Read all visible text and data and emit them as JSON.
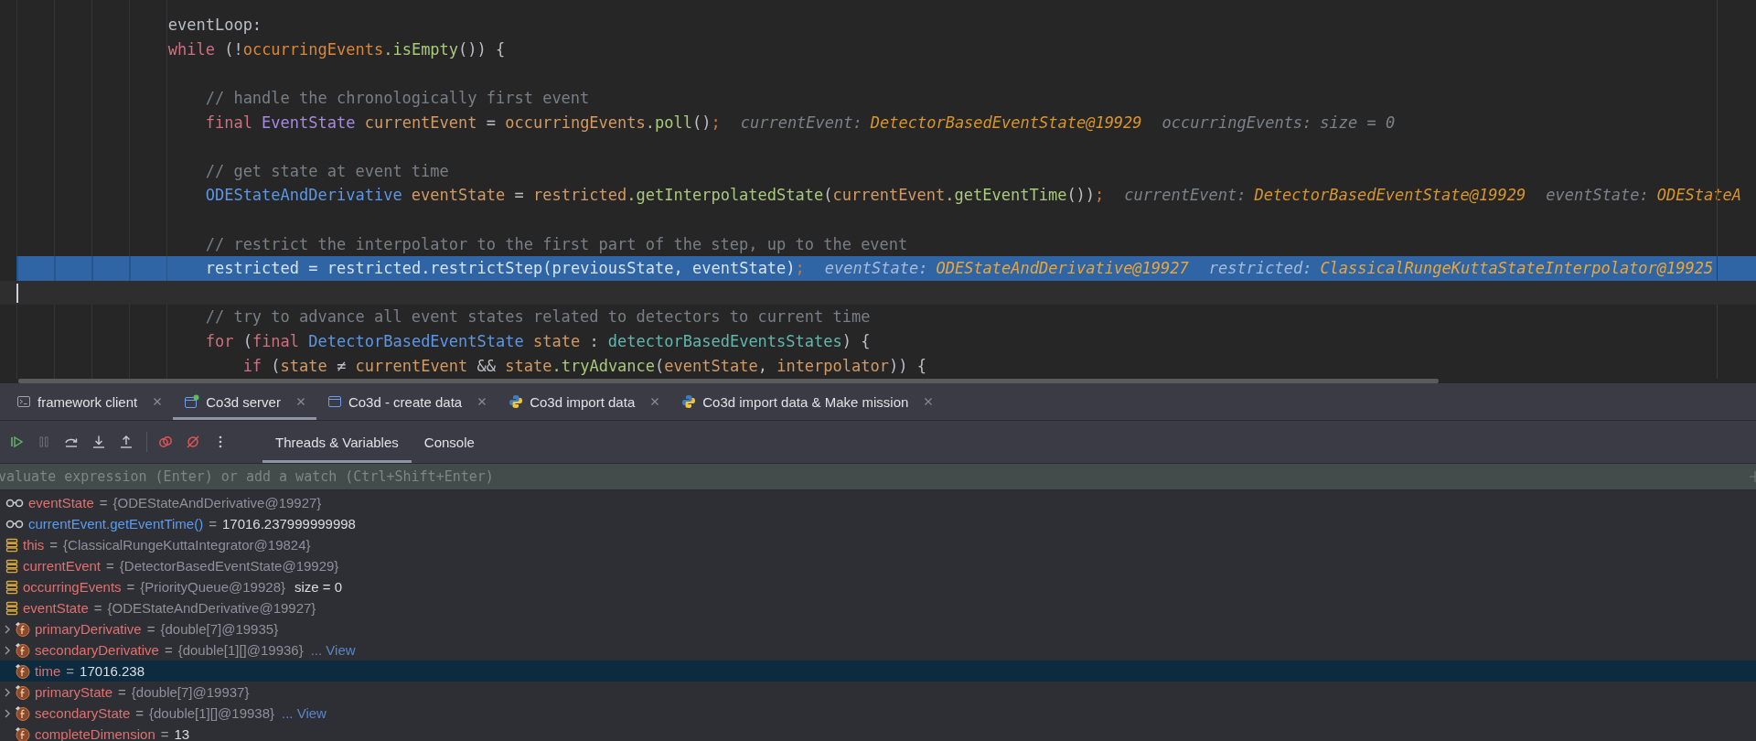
{
  "editor": {
    "lines": [
      {
        "kind": "code",
        "tokens": [
          {
            "kind": "label",
            "text": "                eventLoop:"
          }
        ]
      },
      {
        "kind": "code",
        "tokens": [
          {
            "kind": "kw",
            "text": "                while"
          },
          {
            "kind": "plain",
            "text": " (!"
          },
          {
            "kind": "field",
            "text": "occurringEvents"
          },
          {
            "kind": "method",
            "text": ".isEmpty"
          },
          {
            "kind": "plain",
            "text": "()) {"
          }
        ]
      },
      {
        "kind": "blank"
      },
      {
        "kind": "code",
        "tokens": [
          {
            "kind": "comment",
            "text": "                    // handle the chronologically first event"
          }
        ]
      },
      {
        "kind": "code",
        "tokens": [
          {
            "kind": "kw",
            "text": "                    final "
          },
          {
            "kind": "type2",
            "text": "EventState "
          },
          {
            "kind": "local",
            "text": "currentEvent"
          },
          {
            "kind": "plain",
            "text": " = "
          },
          {
            "kind": "local",
            "text": "occurringEvents"
          },
          {
            "kind": "method",
            "text": ".poll"
          },
          {
            "kind": "plain",
            "text": "()"
          },
          {
            "kind": "semi",
            "text": ";"
          }
        ],
        "hints": [
          {
            "label": "currentEvent:",
            "value": {
              "text": "DetectorBasedEventState@19929",
              "color": "#d8952c"
            }
          },
          {
            "label": "occurringEvents:",
            "value": {
              "text": "size = 0",
              "color": "#7d8188"
            }
          }
        ]
      },
      {
        "kind": "blank"
      },
      {
        "kind": "code",
        "tokens": [
          {
            "kind": "comment",
            "text": "                    // get state at event time"
          }
        ]
      },
      {
        "kind": "code",
        "tokens": [
          {
            "kind": "type",
            "text": "                    ODEStateAndDerivative "
          },
          {
            "kind": "local",
            "text": "eventState"
          },
          {
            "kind": "plain",
            "text": " = "
          },
          {
            "kind": "local",
            "text": "restricted"
          },
          {
            "kind": "method",
            "text": ".getInterpolatedState"
          },
          {
            "kind": "plain",
            "text": "("
          },
          {
            "kind": "local",
            "text": "currentEvent"
          },
          {
            "kind": "method",
            "text": ".getEventTime"
          },
          {
            "kind": "plain",
            "text": "())"
          },
          {
            "kind": "semi",
            "text": ";"
          }
        ],
        "hints": [
          {
            "label": "currentEvent:",
            "value": {
              "text": "DetectorBasedEventState@19929",
              "color": "#d8952c"
            }
          },
          {
            "label": "eventState:",
            "value": {
              "text": "ODEStateA",
              "color": "#d8952c"
            }
          }
        ]
      },
      {
        "kind": "blank"
      },
      {
        "kind": "code",
        "tokens": [
          {
            "kind": "comment",
            "text": "                    // restrict the interpolator to the first part of the step, up to the event"
          }
        ]
      },
      {
        "kind": "code",
        "execution_point": true,
        "tokens": [
          {
            "kind": "local",
            "text": "                    restricted"
          },
          {
            "kind": "plain",
            "text": " = "
          },
          {
            "kind": "local",
            "text": "restricted"
          },
          {
            "kind": "method",
            "text": ".restrictStep"
          },
          {
            "kind": "plain",
            "text": "("
          },
          {
            "kind": "local",
            "text": "previousState"
          },
          {
            "kind": "plain",
            "text": ", "
          },
          {
            "kind": "local",
            "text": "eventState"
          },
          {
            "kind": "plain",
            "text": ")"
          },
          {
            "kind": "semi",
            "text": ";"
          }
        ],
        "hints": [
          {
            "label": "eventState:",
            "value": {
              "text": "ODEStateAndDerivative@19927",
              "color": "#e8a63a"
            }
          },
          {
            "label": "restricted:",
            "value": {
              "text": "ClassicalRungeKuttaStateInterpolator@19925",
              "color": "#e8a63a"
            }
          }
        ]
      },
      {
        "kind": "caret"
      },
      {
        "kind": "code",
        "tokens": [
          {
            "kind": "comment",
            "text": "                    // try to advance all event states related to detectors to current time"
          }
        ]
      },
      {
        "kind": "code",
        "tokens": [
          {
            "kind": "kw",
            "text": "                    for"
          },
          {
            "kind": "plain",
            "text": " ("
          },
          {
            "kind": "kw",
            "text": "final "
          },
          {
            "kind": "type",
            "text": "DetectorBasedEventState "
          },
          {
            "kind": "local",
            "text": "state"
          },
          {
            "kind": "plain",
            "text": " : "
          },
          {
            "kind": "teal",
            "text": "detectorBasedEventsStates"
          },
          {
            "kind": "plain",
            "text": ") {"
          }
        ]
      },
      {
        "kind": "code",
        "tokens": [
          {
            "kind": "kw",
            "text": "                        if"
          },
          {
            "kind": "plain",
            "text": " ("
          },
          {
            "kind": "local",
            "text": "state"
          },
          {
            "kind": "plain",
            "text": " ≠ "
          },
          {
            "kind": "local",
            "text": "currentEvent"
          },
          {
            "kind": "plain",
            "text": " && "
          },
          {
            "kind": "local",
            "text": "state"
          },
          {
            "kind": "method",
            "text": ".tryAdvance"
          },
          {
            "kind": "plain",
            "text": "("
          },
          {
            "kind": "local",
            "text": "eventState"
          },
          {
            "kind": "plain",
            "text": ", "
          },
          {
            "kind": "local",
            "text": "interpolator"
          },
          {
            "kind": "plain",
            "text": ")) {"
          }
        ]
      }
    ]
  },
  "run_tabs": [
    {
      "label": "framework client",
      "selected": false
    },
    {
      "label": "Co3d server",
      "selected": true
    },
    {
      "label": "Co3d - create data",
      "selected": false
    },
    {
      "label": "Co3d import data",
      "selected": false
    },
    {
      "label": "Co3d import data & Make mission",
      "selected": false
    }
  ],
  "debug_toolbar": {
    "actions": [
      {
        "kind": "resume",
        "disabled": false
      },
      {
        "kind": "pause",
        "disabled": true
      },
      {
        "kind": "step-over",
        "disabled": false
      },
      {
        "kind": "step-into",
        "disabled": false
      },
      {
        "kind": "step-out",
        "disabled": false
      },
      {
        "kind": "separator"
      },
      {
        "kind": "breakpoints",
        "disabled": false
      },
      {
        "kind": "mute-breakpoints",
        "disabled": false
      },
      {
        "kind": "more",
        "disabled": false
      }
    ],
    "tabs": [
      {
        "label": "Threads & Variables",
        "selected": true
      },
      {
        "label": "Console",
        "selected": false
      }
    ]
  },
  "evaluate": {
    "placeholder": "valuate expression (Enter) or add a watch (Ctrl+Shift+Enter)"
  },
  "variables": [
    {
      "kind": "watch",
      "name": "eventState",
      "op": "=",
      "value": {
        "text": "{ODEStateAndDerivative@19927}",
        "color": "#8f9098"
      },
      "selected": false
    },
    {
      "kind": "expression",
      "name": "currentEvent.getEventTime()",
      "op": "=",
      "value": {
        "text": "17016.237999999998",
        "color": "#dcdde2"
      },
      "selected": false
    },
    {
      "kind": "local",
      "name": "this",
      "op": "=",
      "value": {
        "text": "{ClassicalRungeKuttaIntegrator@19824}",
        "color": "#8f9098"
      },
      "selected": false
    },
    {
      "kind": "local",
      "name": "currentEvent",
      "op": "=",
      "value": {
        "text": "{DetectorBasedEventState@19929}",
        "color": "#8f9098"
      },
      "selected": false
    },
    {
      "kind": "local",
      "name": "occurringEvents",
      "op": "=",
      "value": {
        "text": "{PriorityQueue@19928}",
        "color": "#8f9098"
      },
      "extra": "size = 0",
      "selected": false
    },
    {
      "kind": "local",
      "name": "eventState",
      "op": "=",
      "value": {
        "text": "{ODEStateAndDerivative@19927}",
        "color": "#8f9098"
      },
      "selected": false,
      "children": [
        {
          "kind": "field",
          "name": "primaryDerivative",
          "op": "=",
          "value": {
            "text": "{double[7]@19935}",
            "color": "#8f9098"
          },
          "expandable": true,
          "selected": false
        },
        {
          "kind": "field",
          "name": "secondaryDerivative",
          "op": "=",
          "value": {
            "text": "{double[1][]@19936}",
            "color": "#8f9098"
          },
          "link": "... View",
          "expandable": true,
          "selected": false
        },
        {
          "kind": "field",
          "name": "time",
          "op": "=",
          "value": {
            "text": "17016.238",
            "color": "#dcdde2"
          },
          "expandable": false,
          "selected": true
        },
        {
          "kind": "field",
          "name": "primaryState",
          "op": "=",
          "value": {
            "text": "{double[7]@19937}",
            "color": "#8f9098"
          },
          "expandable": true,
          "selected": false
        },
        {
          "kind": "field",
          "name": "secondaryState",
          "op": "=",
          "value": {
            "text": "{double[1][]@19938}",
            "color": "#8f9098"
          },
          "link": "... View",
          "expandable": true,
          "selected": false
        },
        {
          "kind": "field",
          "name": "completeDimension",
          "op": "=",
          "value": {
            "text": "13",
            "color": "#dcdde2"
          },
          "expandable": false,
          "selected": false
        }
      ]
    }
  ]
}
